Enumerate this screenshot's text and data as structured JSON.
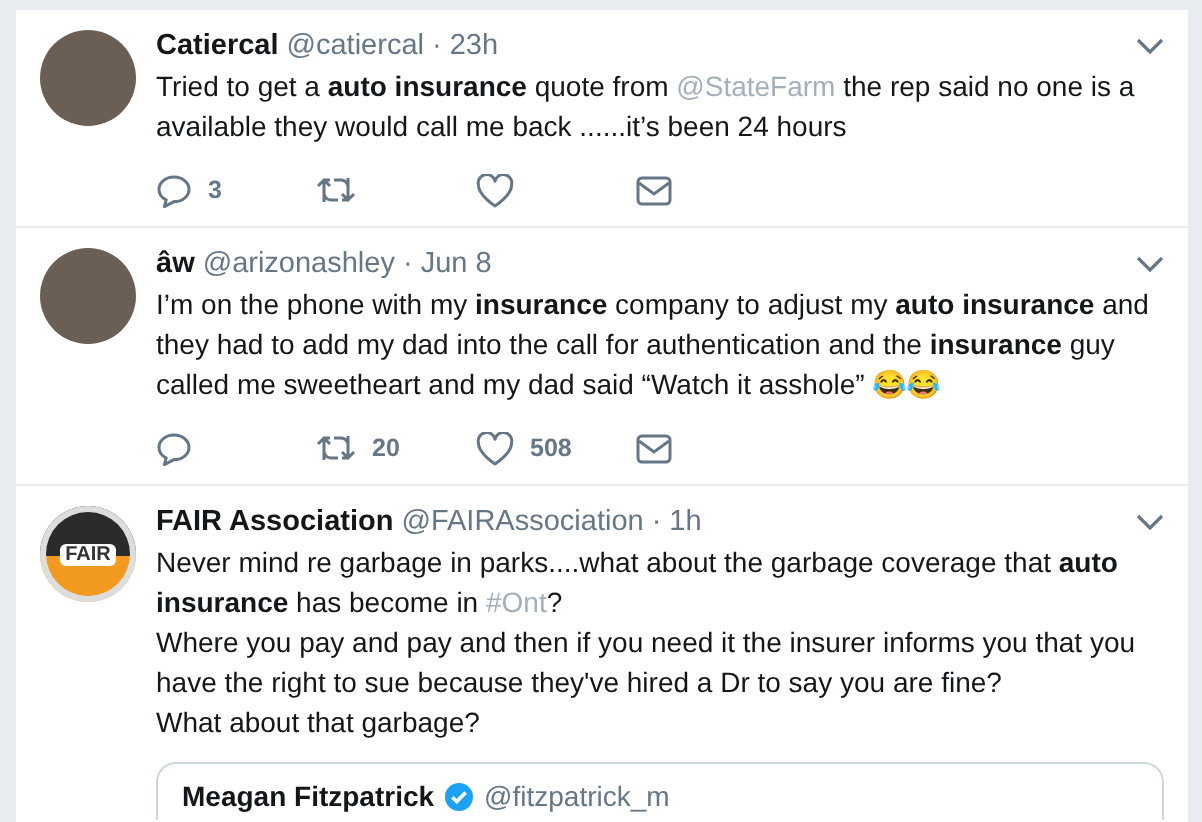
{
  "tweets": [
    {
      "name": "Catiercal",
      "handle": "@catiercal",
      "time": "· 23h",
      "kind": "photo",
      "segments": [
        {
          "kind": "plain",
          "text": "Tried to get a "
        },
        {
          "kind": "bold",
          "text": "auto insurance"
        },
        {
          "kind": "plain",
          "text": " quote from "
        },
        {
          "kind": "link",
          "text": "@StateFarm"
        },
        {
          "kind": "plain",
          "text": "  the rep said no one is a available they would call me back ......it’s been 24 hours"
        }
      ],
      "actions": [
        {
          "kind": "reply",
          "count": "3"
        },
        {
          "kind": "retweet"
        },
        {
          "kind": "like"
        },
        {
          "kind": "mail"
        }
      ]
    },
    {
      "name": "âw",
      "handle": "@arizonashley",
      "time": "· Jun 8",
      "kind": "photo",
      "segments": [
        {
          "kind": "plain",
          "text": "I’m on the phone with my "
        },
        {
          "kind": "bold",
          "text": "insurance"
        },
        {
          "kind": "plain",
          "text": " company to adjust my "
        },
        {
          "kind": "bold",
          "text": "auto insurance"
        },
        {
          "kind": "plain",
          "text": " and they had to add my dad into the call for authentication and the "
        },
        {
          "kind": "bold",
          "text": "insurance"
        },
        {
          "kind": "plain",
          "text": " guy called me sweetheart and my dad said “Watch it asshole” 😂😂"
        }
      ],
      "actions": [
        {
          "kind": "reply"
        },
        {
          "kind": "retweet",
          "count": "20"
        },
        {
          "kind": "like",
          "count": "508"
        },
        {
          "kind": "mail"
        }
      ]
    },
    {
      "name": "FAIR Association",
      "handle": "@FAIRAssociation",
      "time": "· 1h",
      "kind": "logo",
      "logo_text": "FAIR",
      "segments": [
        {
          "kind": "plain",
          "text": "Never mind re garbage in parks....what about the garbage coverage that "
        },
        {
          "kind": "bold",
          "text": "auto insurance"
        },
        {
          "kind": "plain",
          "text": " has become in "
        },
        {
          "kind": "link",
          "text": "#Ont"
        },
        {
          "kind": "plain",
          "text": "?\nWhere you pay and pay and then if you need it the insurer informs you that you have the right to sue because they've hired a Dr to say you are fine?\nWhat about that garbage?"
        }
      ],
      "quote": {
        "name": "Meagan Fitzpatrick",
        "verified": true,
        "handle": "@fitzpatrick_m"
      }
    }
  ]
}
